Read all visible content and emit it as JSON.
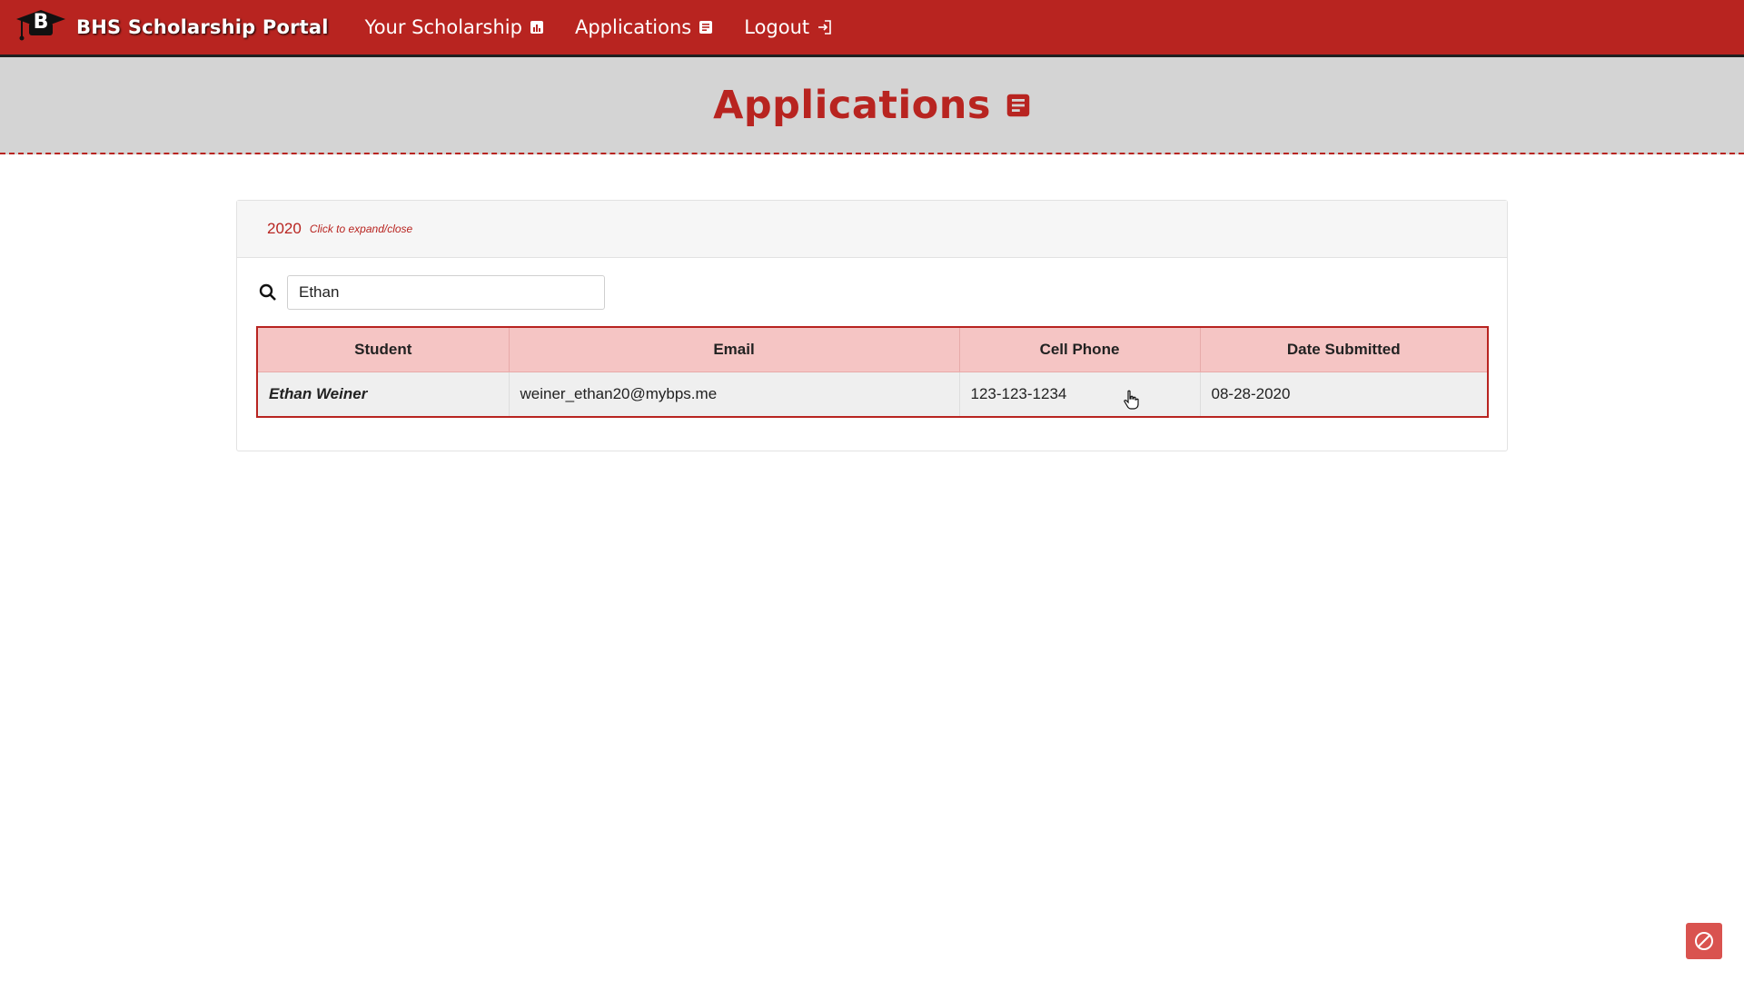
{
  "navbar": {
    "brand_title": "BHS Scholarship Portal",
    "logo_letter": "B",
    "links": [
      {
        "label": "Your Scholarship",
        "icon": "chart-icon"
      },
      {
        "label": "Applications",
        "icon": "document-icon"
      },
      {
        "label": "Logout",
        "icon": "logout-icon"
      }
    ]
  },
  "page": {
    "title": "Applications",
    "title_icon": "document-icon"
  },
  "card": {
    "year": "2020",
    "hint": "Click to expand/close",
    "search": {
      "value": "Ethan",
      "icon": "search-icon"
    },
    "table": {
      "columns": [
        "Student",
        "Email",
        "Cell Phone",
        "Date Submitted"
      ],
      "rows": [
        {
          "student": "Ethan Weiner",
          "email": "weiner_ethan20@mybps.me",
          "phone": "123-123-1234",
          "date": "08-28-2020"
        }
      ]
    }
  },
  "colors": {
    "brand_red": "#b82420",
    "header_pink": "#f5c5c4",
    "page_header_gray": "#d4d4d4"
  }
}
